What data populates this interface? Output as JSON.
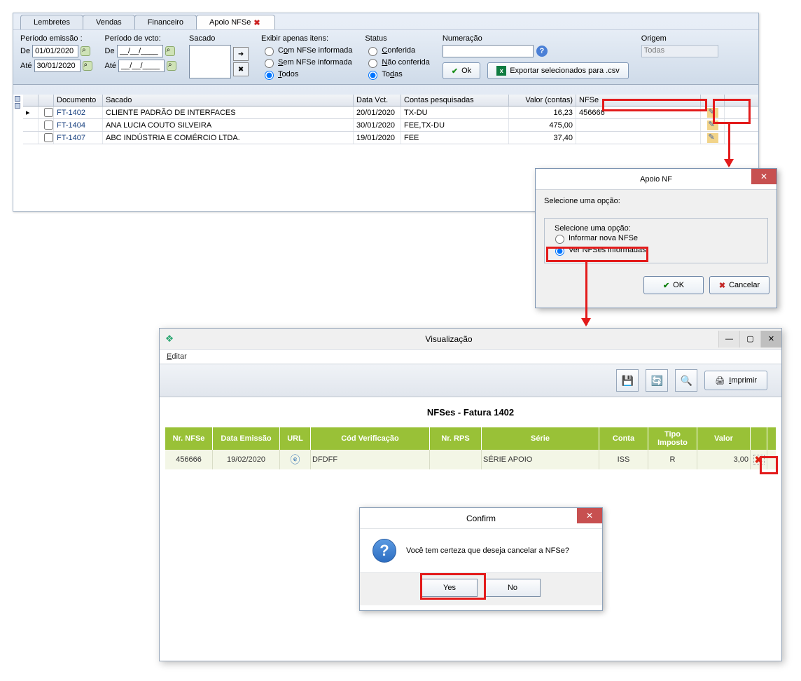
{
  "tabs": {
    "lembretes": "Lembretes",
    "vendas": "Vendas",
    "financeiro": "Financeiro",
    "apoio": "Apoio NFSe"
  },
  "filters": {
    "periodo_emissao_label": "Período emissão :",
    "periodo_vcto_label": "Período de vcto:",
    "de_label": "De",
    "ate_label": "Até",
    "de_emissao": "01/01/2020",
    "ate_emissao": "30/01/2020",
    "de_vcto": "__/__/____",
    "ate_vcto": "__/__/____",
    "sacado_label": "Sacado",
    "exibir_label": "Exibir apenas itens:",
    "exibir_opts": {
      "com": "Com NFSe informada",
      "sem": "Sem NFSe informada",
      "todos": "Todos"
    },
    "status_label": "Status",
    "status_opts": {
      "conf": "Conferida",
      "nconf": "Não conferida",
      "todas": "Todas"
    },
    "numeracao_label": "Numeração",
    "origem_label": "Origem",
    "origem_value": "Todas",
    "ok_label": "Ok",
    "export_label": "Exportar selecionados para .csv"
  },
  "grid": {
    "headers": {
      "documento": "Documento",
      "sacado": "Sacado",
      "data": "Data Vct.",
      "contas": "Contas pesquisadas",
      "valor": "Valor (contas)",
      "nfse": "NFSe"
    },
    "rows": [
      {
        "doc": "FT-1402",
        "sacado": "CLIENTE PADRÃO DE INTERFACES",
        "data": "20/01/2020",
        "contas": "TX-DU",
        "valor": "16,23",
        "nfse": "456666"
      },
      {
        "doc": "FT-1404",
        "sacado": "ANA LUCIA COUTO SILVEIRA",
        "data": "30/01/2020",
        "contas": "FEE,TX-DU",
        "valor": "475,00",
        "nfse": ""
      },
      {
        "doc": "FT-1407",
        "sacado": "ABC INDÚSTRIA E COMÉRCIO LTDA.",
        "data": "19/01/2020",
        "contas": "FEE",
        "valor": "37,40",
        "nfse": ""
      }
    ]
  },
  "apoio_dialog": {
    "title": "Apoio NF",
    "legend_outer": "Selecione uma opção:",
    "legend_inner": "Selecione uma opção:",
    "opts": {
      "informar": "Informar nova NFSe",
      "ver": "Ver NFSes informadas"
    },
    "ok": "OK",
    "cancel": "Cancelar"
  },
  "visu": {
    "title": "Visualização",
    "menu_editar": "Editar",
    "print": "Imprimir",
    "heading": "NFSes - Fatura 1402",
    "headers": {
      "nr": "Nr. NFSe",
      "dataem": "Data Emissão",
      "url": "URL",
      "cod": "Cód Verificação",
      "rps": "Nr. RPS",
      "serie": "Série",
      "conta": "Conta",
      "tipo": "Tipo Imposto",
      "valor": "Valor"
    },
    "row": {
      "nr": "456666",
      "dataem": "19/02/2020",
      "cod": "DFDFF",
      "rps": "",
      "serie": "SÉRIE APOIO",
      "conta": "ISS",
      "tipo": "R",
      "valor": "3,00"
    }
  },
  "confirm": {
    "title": "Confirm",
    "msg": "Você tem certeza que deseja cancelar a NFSe?",
    "yes": "Yes",
    "no": "No"
  }
}
